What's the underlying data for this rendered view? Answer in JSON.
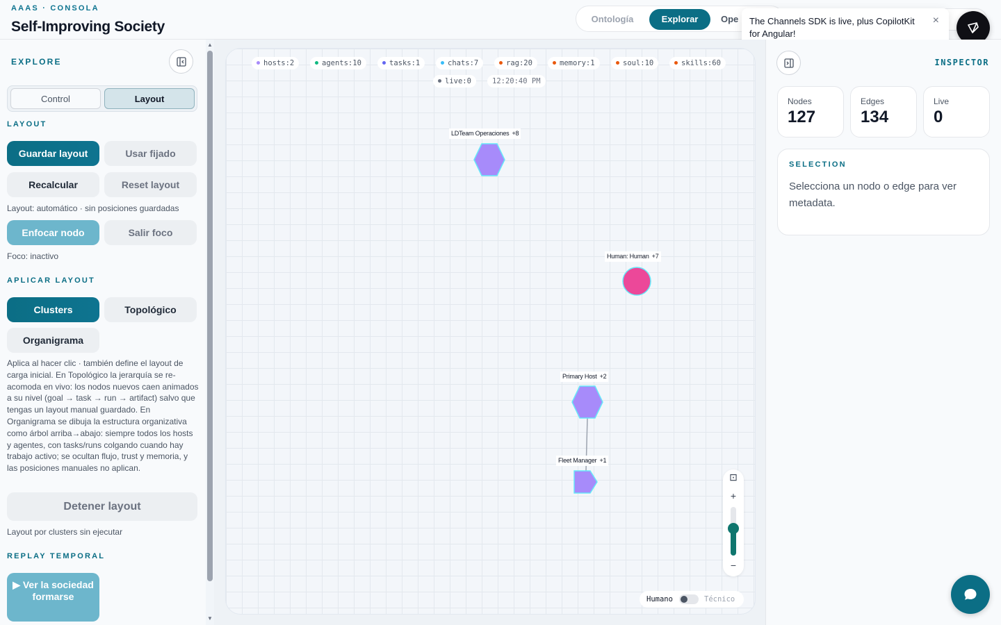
{
  "header": {
    "subtitle": "AAAS · CONSOLA",
    "title": "Self-Improving Society",
    "tabs": [
      "Ontología",
      "Explorar",
      "Ope"
    ]
  },
  "toast": {
    "message": "The Channels SDK is live, plus CopilotKit for Angular!",
    "close": "×"
  },
  "sidebar": {
    "section_explore": "EXPLORE",
    "mode_tabs": [
      "Control",
      "Layout"
    ],
    "active_mode": "Layout",
    "layout_heading": "LAYOUT",
    "layout_buttons": [
      "Guardar layout",
      "Usar fijado",
      "Recalcular",
      "Reset layout"
    ],
    "layout_status": "Layout: automático · sin posiciones guardadas",
    "focus_buttons": [
      "Enfocar nodo",
      "Salir foco"
    ],
    "focus_status": "Foco: inactivo",
    "apply_heading": "APLICAR LAYOUT",
    "apply_buttons": [
      "Clusters",
      "Topológico",
      "Organigrama"
    ],
    "apply_description": "Aplica al hacer clic · también define el layout de carga inicial. En Topológico la jerarquía se re-acomoda en vivo: los nodos nuevos caen animados a su nivel (goal → task → run → artifact) salvo que tengas un layout manual guardado. En Organigrama se dibuja la estructura organizativa como árbol arriba→abajo: siempre todos los hosts y agentes, con tasks/runs colgando cuando hay trabajo activo; se ocultan flujo, trust y memoria, y las posiciones manuales no aplican.",
    "stop_button": "Detener layout",
    "stop_status": "Layout por clusters sin ejecutar",
    "replay_heading": "REPLAY TEMPORAL",
    "replay_button": "▶ Ver la sociedad formarse"
  },
  "canvas": {
    "chips": [
      {
        "label": "hosts:2",
        "color": "#a78bfa"
      },
      {
        "label": "agents:10",
        "color": "#10b981"
      },
      {
        "label": "tasks:1",
        "color": "#6366f1"
      },
      {
        "label": "chats:7",
        "color": "#38bdf8"
      },
      {
        "label": "rag:20",
        "color": "#ea580c"
      },
      {
        "label": "memory:1",
        "color": "#ea580c"
      },
      {
        "label": "soul:10",
        "color": "#ea580c"
      },
      {
        "label": "skills:60",
        "color": "#ea580c"
      },
      {
        "label": "live:0",
        "color": "#6b7280"
      },
      {
        "label": "12:20:40 PM",
        "color": ""
      }
    ],
    "nodes": [
      {
        "label": "LDTeam Operaciones",
        "count": "+8",
        "shape": "hexagon",
        "color": "#a78bfa"
      },
      {
        "label": "Human: Human",
        "count": "+7",
        "shape": "circle",
        "color": "#ec4899"
      },
      {
        "label": "Primary Host",
        "count": "+2",
        "shape": "hexagon",
        "color": "#a78bfa"
      },
      {
        "label": "Fleet Manager",
        "count": "+1",
        "shape": "pentagon",
        "color": "#a78bfa"
      }
    ],
    "zoom": {
      "fit": "⊡",
      "plus": "+",
      "minus": "−",
      "level": 0.55
    },
    "view_toggle": {
      "left": "Humano",
      "right": "Técnico"
    }
  },
  "inspector": {
    "title": "INSPECTOR",
    "stats": [
      {
        "label": "Nodes",
        "value": "127"
      },
      {
        "label": "Edges",
        "value": "134"
      },
      {
        "label": "Live",
        "value": "0"
      }
    ],
    "selection_heading": "SELECTION",
    "selection_text": "Selecciona un nodo o edge para ver metadata."
  }
}
